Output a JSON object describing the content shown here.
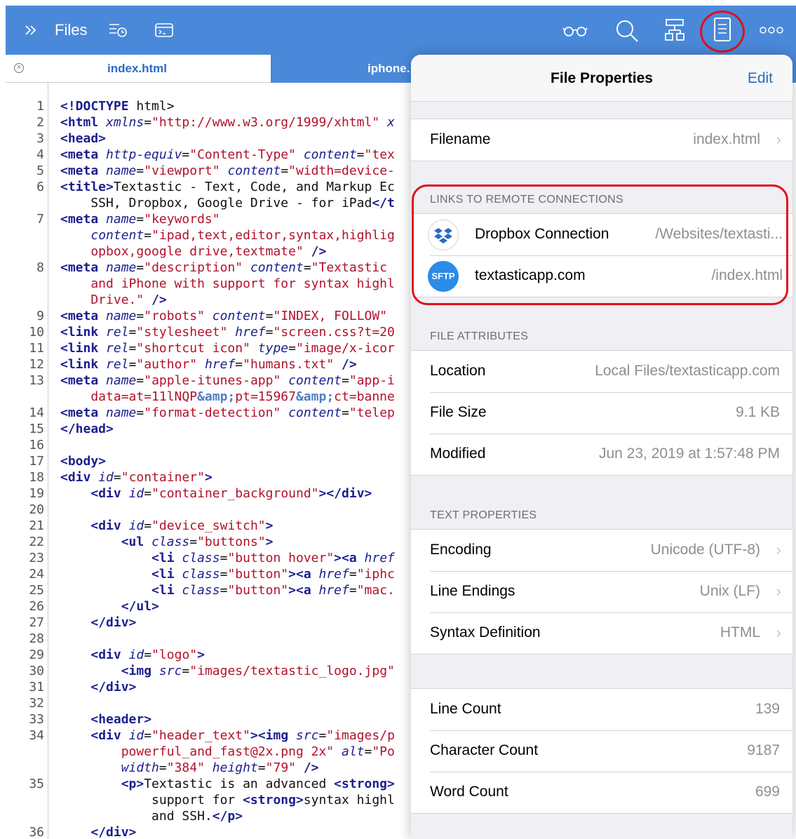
{
  "toolbar": {
    "title": "Files",
    "icons": [
      "sidebar-toggle-icon",
      "recent-files-icon",
      "terminal-icon",
      "glasses-icon",
      "search-icon",
      "symbols-icon",
      "file-properties-icon",
      "more-icon"
    ]
  },
  "tabs": [
    {
      "label": "index.html",
      "active": true
    },
    {
      "label": "iphone.",
      "active": false
    }
  ],
  "editor": {
    "lines": [
      {
        "n": "1",
        "html": "<span class=\"tag\">&lt;!DOCTYPE</span> html&gt;"
      },
      {
        "n": "2",
        "html": "<span class=\"tag\">&lt;html</span> <span class=\"attr\">xmlns</span>=<span class=\"str\">\"http://www.w3.org/1999/xhtml\"</span> <span class=\"attr\">x</span>"
      },
      {
        "n": "3",
        "html": "<span class=\"tag\">&lt;head&gt;</span>"
      },
      {
        "n": "4",
        "html": "<span class=\"tag\">&lt;meta</span> <span class=\"attr\">http-equiv</span>=<span class=\"str\">\"Content-Type\"</span> <span class=\"attr\">content</span>=<span class=\"str\">\"tex</span>"
      },
      {
        "n": "5",
        "html": "<span class=\"tag\">&lt;meta</span> <span class=\"attr\">name</span>=<span class=\"str\">\"viewport\"</span> <span class=\"attr\">content</span>=<span class=\"str\">\"width=device-</span>"
      },
      {
        "n": "6",
        "html": "<span class=\"tag\">&lt;title&gt;</span>Textastic - Text, Code, and Markup Ec"
      },
      {
        "n": "",
        "html": "    SSH, Dropbox, Google Drive - for iPad<span class=\"tag\">&lt;/t</span>"
      },
      {
        "n": "7",
        "html": "<span class=\"tag\">&lt;meta</span> <span class=\"attr\">name</span>=<span class=\"str\">\"keywords\"</span>"
      },
      {
        "n": "",
        "html": "    <span class=\"attr\">content</span>=<span class=\"str\">\"ipad,text,editor,syntax,highlig</span>"
      },
      {
        "n": "",
        "html": "<span class=\"str\">    opbox,google drive,textmate\"</span> <span class=\"tag\">/&gt;</span>"
      },
      {
        "n": "8",
        "html": "<span class=\"tag\">&lt;meta</span> <span class=\"attr\">name</span>=<span class=\"str\">\"description\"</span> <span class=\"attr\">content</span>=<span class=\"str\">\"Textastic</span>"
      },
      {
        "n": "",
        "html": "<span class=\"str\">    and iPhone with support for syntax highl</span>"
      },
      {
        "n": "",
        "html": "<span class=\"str\">    Drive.\"</span> <span class=\"tag\">/&gt;</span>"
      },
      {
        "n": "9",
        "html": "<span class=\"tag\">&lt;meta</span> <span class=\"attr\">name</span>=<span class=\"str\">\"robots\"</span> <span class=\"attr\">content</span>=<span class=\"str\">\"INDEX, FOLLOW\"</span>"
      },
      {
        "n": "10",
        "html": "<span class=\"tag\">&lt;link</span> <span class=\"attr\">rel</span>=<span class=\"str\">\"stylesheet\"</span> <span class=\"attr\">href</span>=<span class=\"str\">\"screen.css?t=20</span>"
      },
      {
        "n": "11",
        "html": "<span class=\"tag\">&lt;link</span> <span class=\"attr\">rel</span>=<span class=\"str\">\"shortcut icon\"</span> <span class=\"attr\">type</span>=<span class=\"str\">\"image/x-icor</span>"
      },
      {
        "n": "12",
        "html": "<span class=\"tag\">&lt;link</span> <span class=\"attr\">rel</span>=<span class=\"str\">\"author\"</span> <span class=\"attr\">href</span>=<span class=\"str\">\"humans.txt\"</span> <span class=\"tag\">/&gt;</span>"
      },
      {
        "n": "13",
        "html": "<span class=\"tag\">&lt;meta</span> <span class=\"attr\">name</span>=<span class=\"str\">\"apple-itunes-app\"</span> <span class=\"attr\">content</span>=<span class=\"str\">\"app-i</span>"
      },
      {
        "n": "",
        "html": "<span class=\"str\">    data=at=11lNQP</span><span class=\"ent\">&amp;amp;</span><span class=\"str\">pt=15967</span><span class=\"ent\">&amp;amp;</span><span class=\"str\">ct=banne</span>"
      },
      {
        "n": "14",
        "html": "<span class=\"tag\">&lt;meta</span> <span class=\"attr\">name</span>=<span class=\"str\">\"format-detection\"</span> <span class=\"attr\">content</span>=<span class=\"str\">\"telep</span>"
      },
      {
        "n": "15",
        "html": "<span class=\"tag\">&lt;/head&gt;</span>"
      },
      {
        "n": "16",
        "html": ""
      },
      {
        "n": "17",
        "html": "<span class=\"tag\">&lt;body&gt;</span>"
      },
      {
        "n": "18",
        "html": "<span class=\"tag\">&lt;div</span> <span class=\"attr\">id</span>=<span class=\"str\">\"container\"</span><span class=\"tag\">&gt;</span>"
      },
      {
        "n": "19",
        "html": "    <span class=\"tag\">&lt;div</span> <span class=\"attr\">id</span>=<span class=\"str\">\"container_background\"</span><span class=\"tag\">&gt;&lt;/div&gt;</span>"
      },
      {
        "n": "20",
        "html": ""
      },
      {
        "n": "21",
        "html": "    <span class=\"tag\">&lt;div</span> <span class=\"attr\">id</span>=<span class=\"str\">\"device_switch\"</span><span class=\"tag\">&gt;</span>"
      },
      {
        "n": "22",
        "html": "        <span class=\"tag\">&lt;ul</span> <span class=\"attr\">class</span>=<span class=\"str\">\"buttons\"</span><span class=\"tag\">&gt;</span>"
      },
      {
        "n": "23",
        "html": "            <span class=\"tag\">&lt;li</span> <span class=\"attr\">class</span>=<span class=\"str\">\"button hover\"</span><span class=\"tag\">&gt;&lt;a</span> <span class=\"attr\">href</span>"
      },
      {
        "n": "24",
        "html": "            <span class=\"tag\">&lt;li</span> <span class=\"attr\">class</span>=<span class=\"str\">\"button\"</span><span class=\"tag\">&gt;&lt;a</span> <span class=\"attr\">href</span>=<span class=\"str\">\"iphc</span>"
      },
      {
        "n": "25",
        "html": "            <span class=\"tag\">&lt;li</span> <span class=\"attr\">class</span>=<span class=\"str\">\"button\"</span><span class=\"tag\">&gt;&lt;a</span> <span class=\"attr\">href</span>=<span class=\"str\">\"mac.</span>"
      },
      {
        "n": "26",
        "html": "        <span class=\"tag\">&lt;/ul&gt;</span>"
      },
      {
        "n": "27",
        "html": "    <span class=\"tag\">&lt;/div&gt;</span>"
      },
      {
        "n": "28",
        "html": ""
      },
      {
        "n": "29",
        "html": "    <span class=\"tag\">&lt;div</span> <span class=\"attr\">id</span>=<span class=\"str\">\"logo\"</span><span class=\"tag\">&gt;</span>"
      },
      {
        "n": "30",
        "html": "        <span class=\"tag\">&lt;img</span> <span class=\"attr\">src</span>=<span class=\"str\">\"images/textastic_logo.jpg\"</span>"
      },
      {
        "n": "31",
        "html": "    <span class=\"tag\">&lt;/div&gt;</span>"
      },
      {
        "n": "32",
        "html": ""
      },
      {
        "n": "33",
        "html": "    <span class=\"tag\">&lt;header&gt;</span>"
      },
      {
        "n": "34",
        "html": "    <span class=\"tag\">&lt;div</span> <span class=\"attr\">id</span>=<span class=\"str\">\"header_text\"</span><span class=\"tag\">&gt;&lt;img</span> <span class=\"attr\">src</span>=<span class=\"str\">\"images/p</span>"
      },
      {
        "n": "",
        "html": "<span class=\"str\">        powerful_and_fast@2x.png 2x\"</span> <span class=\"attr\">alt</span>=<span class=\"str\">\"Po</span>"
      },
      {
        "n": "",
        "html": "        <span class=\"attr\">width</span>=<span class=\"str\">\"384\"</span> <span class=\"attr\">height</span>=<span class=\"str\">\"79\"</span> <span class=\"tag\">/&gt;</span>"
      },
      {
        "n": "35",
        "html": "        <span class=\"tag\">&lt;p&gt;</span>Textastic is an advanced <span class=\"tag\">&lt;strong&gt;</span>"
      },
      {
        "n": "",
        "html": "            support for <span class=\"tag\">&lt;strong&gt;</span>syntax highl"
      },
      {
        "n": "",
        "html": "            and SSH.<span class=\"tag\">&lt;/p&gt;</span>"
      },
      {
        "n": "36",
        "html": "    <span class=\"tag\">&lt;/div&gt;</span>"
      }
    ]
  },
  "panel": {
    "title": "File Properties",
    "edit_label": "Edit",
    "filename": {
      "label": "Filename",
      "value": "index.html"
    },
    "links_header": "LINKS TO REMOTE CONNECTIONS",
    "links": [
      {
        "label": "Dropbox Connection",
        "path": "/Websites/textasti...",
        "icon": "dropbox-icon"
      },
      {
        "label": "textasticapp.com",
        "path": "/index.html",
        "icon": "sftp-icon",
        "badge": "SFTP"
      }
    ],
    "attributes_header": "FILE ATTRIBUTES",
    "attributes": [
      {
        "label": "Location",
        "value": "Local Files/textasticapp.com"
      },
      {
        "label": "File Size",
        "value": "9.1 KB"
      },
      {
        "label": "Modified",
        "value": "Jun 23, 2019 at 1:57:48 PM"
      }
    ],
    "text_header": "TEXT PROPERTIES",
    "text_props": [
      {
        "label": "Encoding",
        "value": "Unicode (UTF-8)"
      },
      {
        "label": "Line Endings",
        "value": "Unix (LF)"
      },
      {
        "label": "Syntax Definition",
        "value": "HTML"
      }
    ],
    "counts": [
      {
        "label": "Line Count",
        "value": "139"
      },
      {
        "label": "Character Count",
        "value": "9187"
      },
      {
        "label": "Word Count",
        "value": "699"
      }
    ]
  },
  "colors": {
    "accent": "#4a89d9",
    "link": "#2a6bc4",
    "highlight": "#e0101c"
  }
}
